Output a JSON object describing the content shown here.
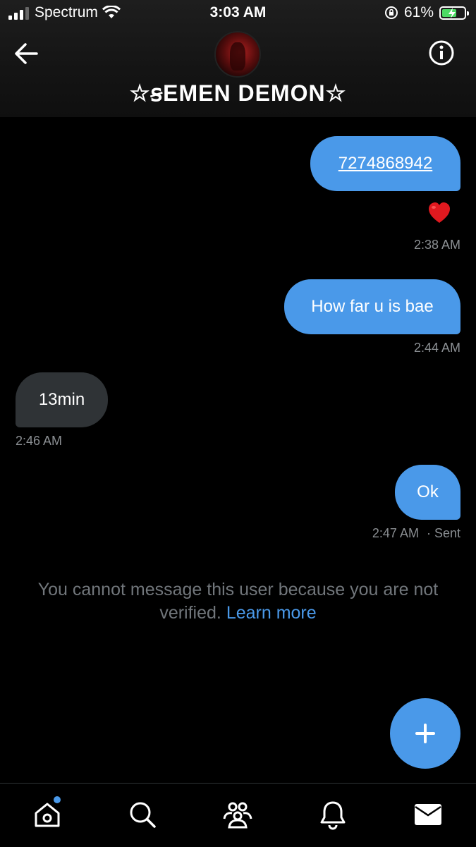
{
  "status_bar": {
    "carrier": "Spectrum",
    "time": "3:03 AM",
    "battery_percent": "61%",
    "battery_level": 0.61
  },
  "header": {
    "title": "☆ꞩEMEN DEMON☆",
    "back_icon": "arrow-left-icon",
    "info_icon": "info-icon"
  },
  "messages": [
    {
      "direction": "outgoing",
      "text": "7274868942",
      "is_link": true,
      "reaction": "❤️",
      "timestamp": "2:38 AM"
    },
    {
      "direction": "outgoing",
      "text": "How far u is bae",
      "timestamp": "2:44 AM"
    },
    {
      "direction": "incoming",
      "text": "13min",
      "timestamp": "2:46 AM"
    },
    {
      "direction": "outgoing",
      "text": "Ok",
      "timestamp": "2:47 AM",
      "status": "· Sent"
    }
  ],
  "notice": {
    "text": "You cannot message this user because you are not verified.",
    "link": "Learn more"
  },
  "fab": {
    "icon": "plus-icon"
  },
  "tabbar": {
    "items": [
      "home-icon",
      "search-icon",
      "communities-icon",
      "notifications-icon",
      "messages-icon"
    ],
    "home_has_dot": true
  },
  "colors": {
    "accent": "#4a99e9",
    "incoming_bubble": "#2f3336",
    "muted_text": "#71767b",
    "background": "#000000"
  }
}
